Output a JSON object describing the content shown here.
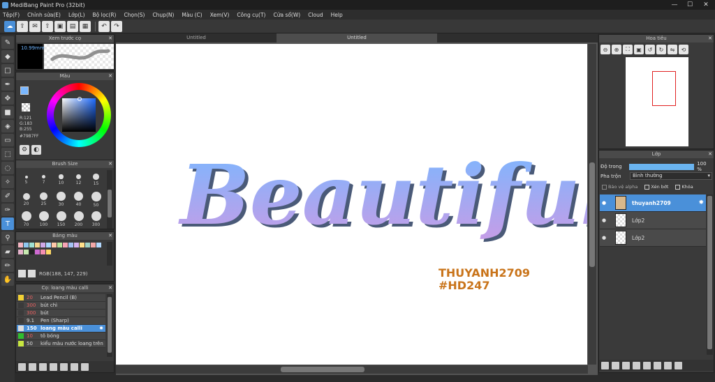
{
  "window": {
    "title": "MediBang Paint Pro (32bit)",
    "minimize": "—",
    "maximize": "☐",
    "close": "✕"
  },
  "menu": [
    "Tệp(F)",
    "Chỉnh sửa(E)",
    "Lớp(L)",
    "Bộ lọc(R)",
    "Chọn(S)",
    "Chụp(N)",
    "Màu (C)",
    "Xem(V)",
    "Công cụ(T)",
    "Cửa sổ(W)",
    "Cloud",
    "Help"
  ],
  "brush_preview": {
    "title": "Xem trước cọ",
    "size": "10.99mm"
  },
  "color": {
    "title": "Màu",
    "r": "R:121",
    "g": "G:183",
    "b": "B:255",
    "hex": "#79B7FF",
    "primary": "#79B7FF",
    "secondary": "#ffffff"
  },
  "brush_size": {
    "title": "Brush Size",
    "sizes": [
      "5",
      "7",
      "10",
      "12",
      "15",
      "20",
      "25",
      "30",
      "40",
      "50",
      "70",
      "100",
      "150",
      "200",
      "300"
    ]
  },
  "palette": {
    "title": "Bảng màu",
    "rgb_readout": "RGB(188, 147, 229)",
    "colors": [
      "#f4b6c2",
      "#8ec7f0",
      "#9ee0d2",
      "#f6d58e",
      "#cfa8e8",
      "#a9d8ff",
      "#ffc9a9",
      "#b9e69b",
      "#f7a3b5",
      "#a4c2f4",
      "#d6b3f0",
      "#ffe08a",
      "#9fd3c7",
      "#f2a7a7",
      "#b3d9ff",
      "#e6b3cc",
      "#c7e9b0",
      "#222222",
      "#cf6ad2",
      "#f48fb1",
      "#ffd966"
    ]
  },
  "brushes": {
    "title": "Cọ: loang màu calli",
    "items": [
      {
        "size": "20",
        "name": "Lead Pencil (B)",
        "color": "#f2d035",
        "size_color": "#e86060"
      },
      {
        "size": "300",
        "name": "bút chì",
        "color": "#3a3a3a",
        "size_color": "#e86060"
      },
      {
        "size": "300",
        "name": "bút",
        "color": "#3a3a3a",
        "size_color": "#e86060"
      },
      {
        "size": "9.1",
        "name": "Pen (Sharp)",
        "color": "#3a3a3a",
        "size_color": "#dddddd"
      },
      {
        "size": "150",
        "name": "loang màu calli",
        "color": "#dddddd",
        "size_color": "#ffffff"
      },
      {
        "size": "10",
        "name": "tô bóng",
        "color": "#2fbf2f",
        "size_color": "#e86060"
      },
      {
        "size": "50",
        "name": "kiểu màu nước loang trên",
        "color": "#c7e640",
        "size_color": "#dddddd"
      }
    ]
  },
  "tabs": [
    "Untitled",
    "Untitled"
  ],
  "artwork": {
    "word": "Beautiful",
    "sig_line1": "THUYANH2709",
    "sig_line2": "#HD247"
  },
  "navigator": {
    "title": "Hoa tiêu"
  },
  "layers": {
    "title": "Lớp",
    "opacity_label": "Độ trong",
    "opacity_value": "100 %",
    "opacity": 1.0,
    "blend_label": "Pha trộn",
    "blend_value": "Bình thường",
    "protect_alpha": "Bảo vệ alpha",
    "clipping": "Xén bớt",
    "lock": "Khóa",
    "items": [
      {
        "name": "thuyanh2709"
      },
      {
        "name": "Lớp2"
      },
      {
        "name": "Lớp2"
      }
    ]
  }
}
